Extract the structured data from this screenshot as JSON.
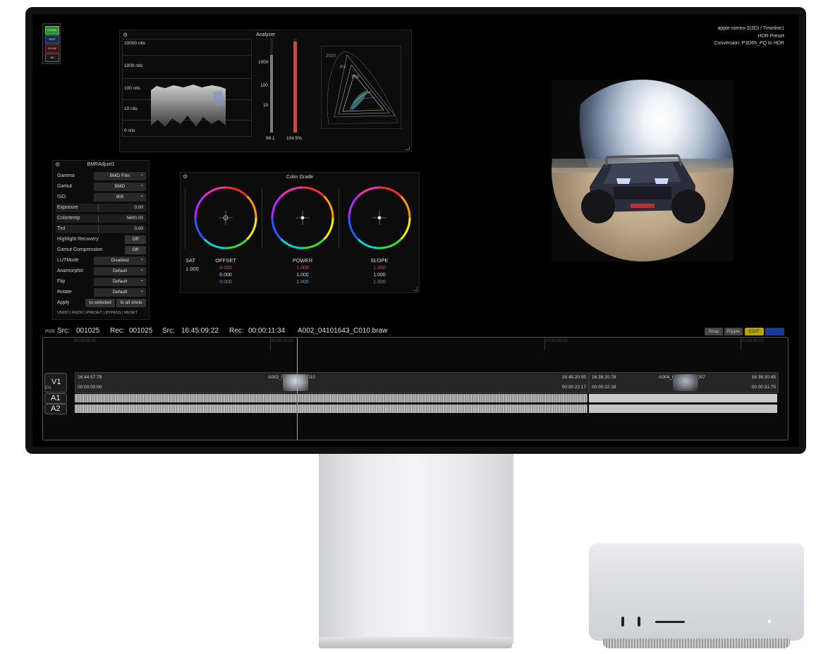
{
  "header_info": {
    "line1": "apple-stereo-2(3D) / Timeline1",
    "line2": "HDR Preset",
    "line3": "Conversion: P3D65_PQ to HDR"
  },
  "mode_buttons": [
    "GLOBAL",
    "SHOT",
    "GROUP",
    "NS"
  ],
  "analyzer": {
    "title": "Analyzer",
    "nits_labels": [
      "10000 nits",
      "1000 nits",
      "100 nits",
      "10 nits",
      "0 nits"
    ],
    "bar_labels": [
      "1000",
      "100",
      "10"
    ],
    "left_value": "99.1",
    "right_value": "104.5%",
    "gamut_labels": [
      "2020",
      "P3",
      "709"
    ],
    "left_bar_fraction": 0.83,
    "right_bar_fraction": 0.97
  },
  "bmr": {
    "title": "BMRAdjust1",
    "rows": [
      {
        "label": "Gamma",
        "value": "BMD Film",
        "type": "select"
      },
      {
        "label": "Gamut",
        "value": "BMD",
        "type": "select"
      },
      {
        "label": "ISO",
        "value": "800",
        "type": "select"
      },
      {
        "label": "Exposure",
        "value": "0.00",
        "type": "slider"
      },
      {
        "label": "Colortemp",
        "value": "5600.00",
        "type": "slider"
      },
      {
        "label": "Tint",
        "value": "0.00",
        "type": "slider"
      },
      {
        "label": "Highlight Recovery",
        "value": "Off",
        "type": "toggle"
      },
      {
        "label": "Gamut Compression",
        "value": "Off",
        "type": "toggle"
      },
      {
        "label": "LUTMode",
        "value": "Disabled",
        "type": "select"
      },
      {
        "label": "Anamorphic",
        "value": "Default",
        "type": "select"
      },
      {
        "label": "Flip",
        "value": "Default",
        "type": "select"
      },
      {
        "label": "Rotate",
        "value": "Default",
        "type": "select"
      }
    ],
    "apply_label": "Apply",
    "apply_selected": "to selected",
    "apply_all": "to all shots",
    "footer_links": "UNDO | REDO | PRESET | BYPASS | RESET"
  },
  "color_grade": {
    "title": "Color Grade",
    "sat_label": "SAT",
    "sat_value": "1.000",
    "wheels": [
      {
        "label": "OFFSET",
        "r": "0.000",
        "g": "0.000",
        "b": "0.000"
      },
      {
        "label": "POWER",
        "r": "1.000",
        "g": "1.000",
        "b": "1.000"
      },
      {
        "label": "SLOPE",
        "r": "1.000",
        "g": "1.000",
        "b": "1.000"
      }
    ]
  },
  "status_bar": {
    "pos": "POS",
    "src_label": "Src:",
    "src_frame": "001025",
    "rec_label": "Rec:",
    "rec_frame": "001025",
    "src_tc_label": "Src:",
    "src_tc": "16:45:09:22",
    "rec_tc_label": "Rec:",
    "rec_tc": "00:00:11:34",
    "clip": "A002_04101643_C010.braw",
    "snap": "Snap",
    "ripple": "Ripple",
    "edit": "EDIT"
  },
  "timeline": {
    "ruler": [
      "00:00:00:00",
      "00:00:10:00",
      "00:00:20:00",
      "00:00:30:00"
    ],
    "v1": "V1",
    "en": "EN",
    "a1": "A1",
    "a2": "A2",
    "clip1": {
      "name": "A002_04101643_C010",
      "src_in": "16:44:57:78",
      "rec_in": "00:00:00:00",
      "src_out": "16:45:20:05",
      "rec_out": "00:00:22:17"
    },
    "clip2": {
      "name": "A004_04111435_C007",
      "src_in": "16:38:20:78",
      "rec_in": "00:00:22:18",
      "src_out": "16:38:30:45",
      "rec_out": "00:00:31:75"
    }
  },
  "colors": {
    "mode_global": "#2e8b2e",
    "mode_shot": "#2a4f8a",
    "mode_group": "#8a2a2a",
    "playhead": "#e0a020",
    "edit_btn": "#c8b400",
    "offset_r": "#e04848",
    "offset_b": "#3aa0e0"
  },
  "icons": [
    "gear-icon",
    "chevron-down-icon"
  ]
}
